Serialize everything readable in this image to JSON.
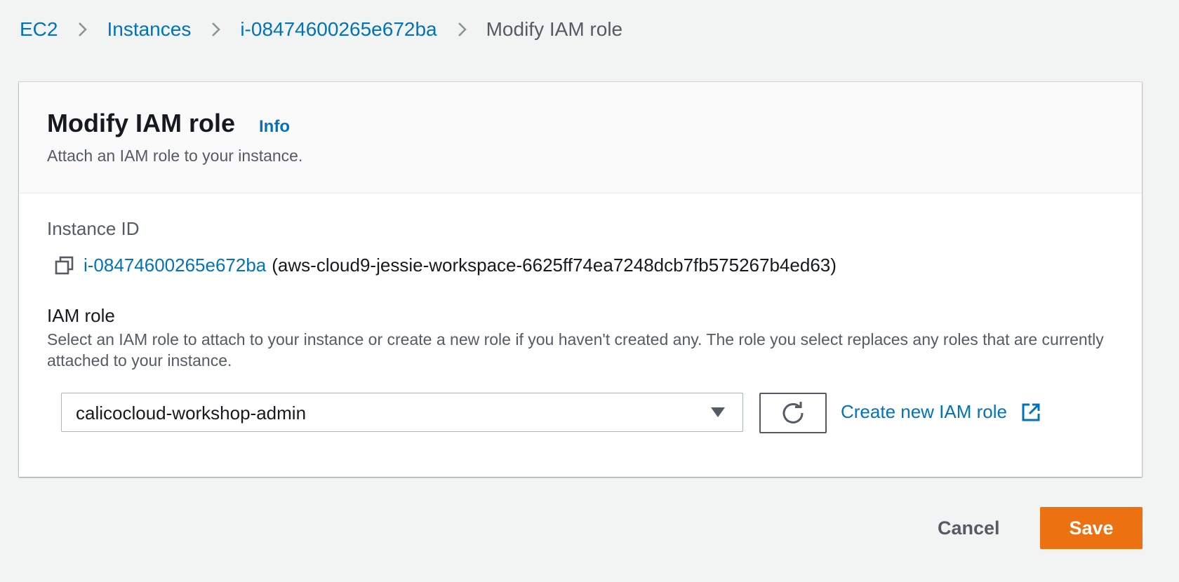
{
  "breadcrumb": {
    "items": [
      "EC2",
      "Instances",
      "i-08474600265e672ba"
    ],
    "current": "Modify IAM role"
  },
  "panel": {
    "title": "Modify IAM role",
    "info_label": "Info",
    "description": "Attach an IAM role to your instance."
  },
  "instance": {
    "label": "Instance ID",
    "id": "i-08474600265e672ba",
    "name": "(aws-cloud9-jessie-workspace-6625ff74ea7248dcb7fb575267b4ed63)"
  },
  "iam_role": {
    "label": "IAM role",
    "description": "Select an IAM role to attach to your instance or create a new role if you haven't created any. The role you select replaces any roles that are currently attached to your instance.",
    "selected": "calicocloud-workshop-admin",
    "create_label": "Create new IAM role"
  },
  "actions": {
    "cancel_label": "Cancel",
    "save_label": "Save"
  },
  "icons": {
    "breadcrumb_separator": "chevron-right-icon",
    "copy": "copy-icon",
    "dropdown": "caret-down-icon",
    "refresh": "refresh-icon",
    "external": "external-link-icon"
  },
  "colors": {
    "link": "#0073bb",
    "primary_button": "#ec7211",
    "background": "#f2f3f3",
    "muted_text": "#545b64"
  }
}
